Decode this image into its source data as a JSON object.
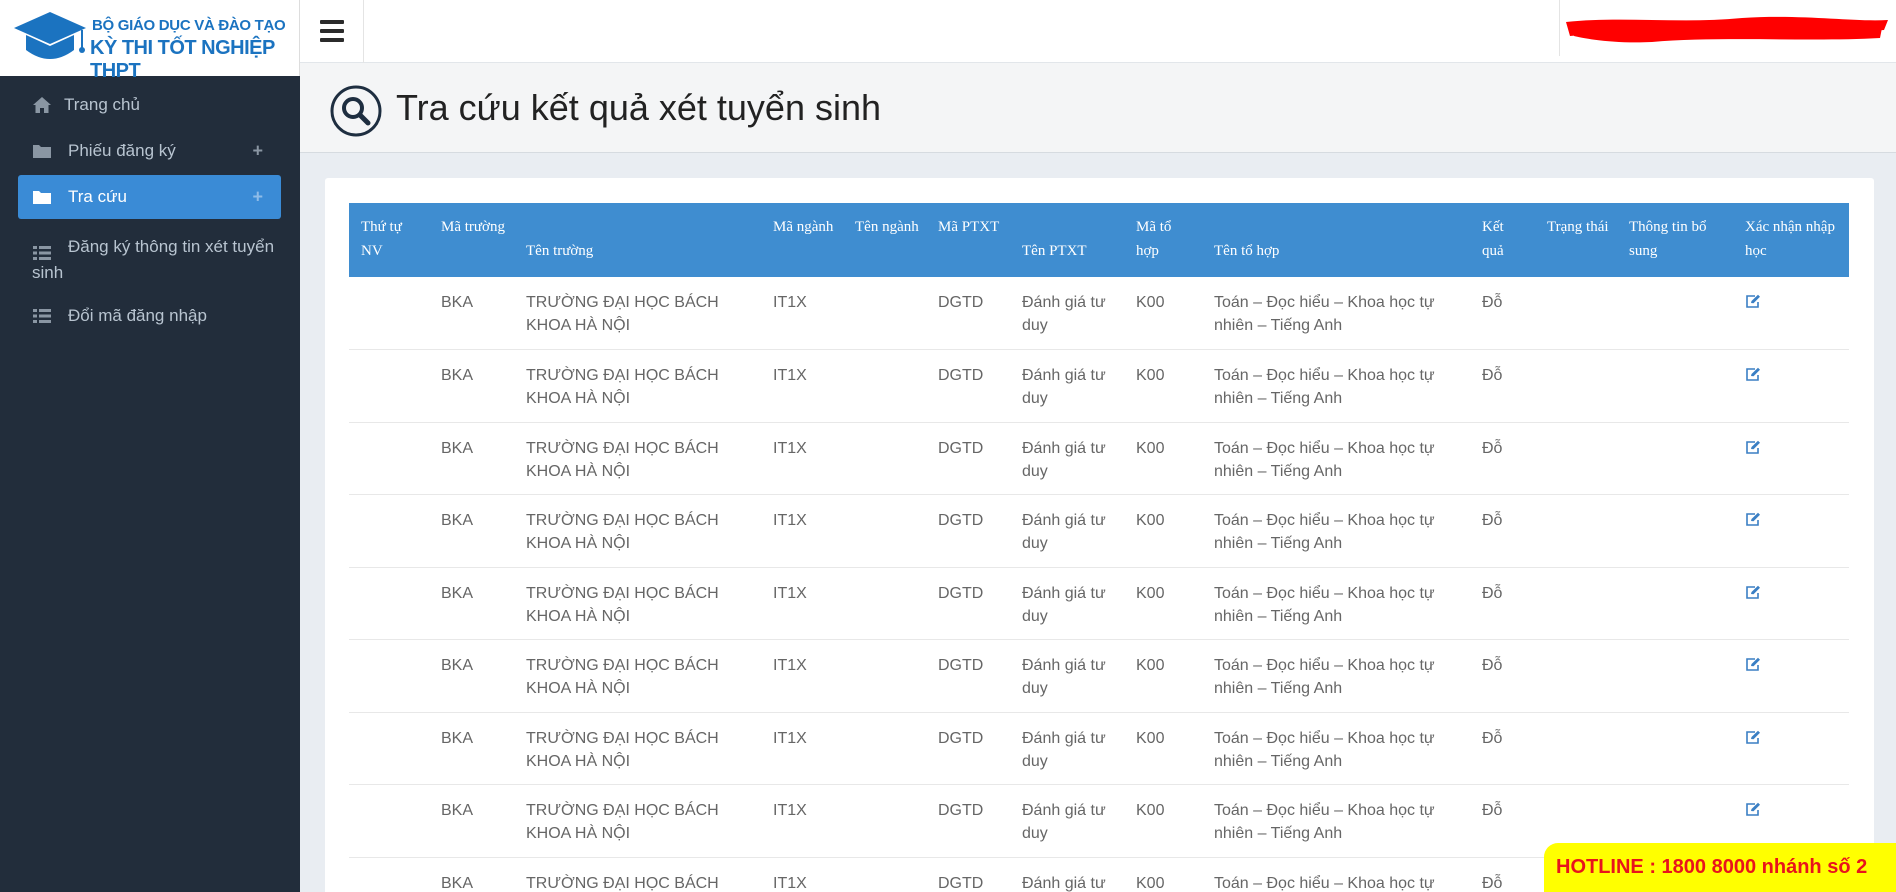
{
  "logo": {
    "line1": "BỘ GIÁO DỤC VÀ ĐÀO TẠO",
    "line2": "KỲ THI TỐT NGHIỆP THPT"
  },
  "sidebar": {
    "items": [
      {
        "label": "Trang chủ",
        "icon": "home-icon"
      },
      {
        "label": "Phiếu đăng ký",
        "icon": "folder-icon",
        "expand": "+"
      },
      {
        "label": "Tra cứu",
        "icon": "folder-icon",
        "expand": "+",
        "active": true
      },
      {
        "label": "Đăng ký thông tin xét tuyển",
        "label_cont": "sinh",
        "icon": "list-icon"
      },
      {
        "label": "Đổi mã đăng nhập",
        "icon": "list-icon"
      }
    ]
  },
  "header": {
    "title": "Tra cứu kết quả xét tuyển sinh"
  },
  "table": {
    "columns": [
      "Thứ tự NV",
      "Mã trường",
      "Tên trường",
      "Mã ngành",
      "Tên ngành",
      "Mã PTXT",
      "Tên PTXT",
      "Mã tổ hợp",
      "Tên tổ hợp",
      "Kết quả",
      "Trạng thái",
      "Thông tin bổ sung",
      "Xác nhận nhập học"
    ],
    "rows": [
      [
        "",
        "BKA",
        "TRƯỜNG ĐẠI HỌC BÁCH KHOA HÀ NỘI",
        "IT1X",
        "",
        "DGTD",
        "Đánh giá tư duy",
        "K00",
        "Toán – Đọc hiểu – Khoa học tự nhiên – Tiếng Anh",
        "Đỗ",
        "",
        ""
      ],
      [
        "",
        "BKA",
        "TRƯỜNG ĐẠI HỌC BÁCH KHOA HÀ NỘI",
        "IT1X",
        "",
        "DGTD",
        "Đánh giá tư duy",
        "K00",
        "Toán – Đọc hiểu – Khoa học tự nhiên – Tiếng Anh",
        "Đỗ",
        "",
        ""
      ],
      [
        "",
        "BKA",
        "TRƯỜNG ĐẠI HỌC BÁCH KHOA HÀ NỘI",
        "IT1X",
        "",
        "DGTD",
        "Đánh giá tư duy",
        "K00",
        "Toán – Đọc hiểu – Khoa học tự nhiên – Tiếng Anh",
        "Đỗ",
        "",
        ""
      ],
      [
        "",
        "BKA",
        "TRƯỜNG ĐẠI HỌC BÁCH KHOA HÀ NỘI",
        "IT1X",
        "",
        "DGTD",
        "Đánh giá tư duy",
        "K00",
        "Toán – Đọc hiểu – Khoa học tự nhiên – Tiếng Anh",
        "Đỗ",
        "",
        ""
      ],
      [
        "",
        "BKA",
        "TRƯỜNG ĐẠI HỌC BÁCH KHOA HÀ NỘI",
        "IT1X",
        "",
        "DGTD",
        "Đánh giá tư duy",
        "K00",
        "Toán – Đọc hiểu – Khoa học tự nhiên – Tiếng Anh",
        "Đỗ",
        "",
        ""
      ],
      [
        "",
        "BKA",
        "TRƯỜNG ĐẠI HỌC BÁCH KHOA HÀ NỘI",
        "IT1X",
        "",
        "DGTD",
        "Đánh giá tư duy",
        "K00",
        "Toán – Đọc hiểu – Khoa học tự nhiên – Tiếng Anh",
        "Đỗ",
        "",
        ""
      ],
      [
        "",
        "BKA",
        "TRƯỜNG ĐẠI HỌC BÁCH KHOA HÀ NỘI",
        "IT1X",
        "",
        "DGTD",
        "Đánh giá tư duy",
        "K00",
        "Toán – Đọc hiểu – Khoa học tự nhiên – Tiếng Anh",
        "Đỗ",
        "",
        ""
      ],
      [
        "",
        "BKA",
        "TRƯỜNG ĐẠI HỌC BÁCH KHOA HÀ NỘI",
        "IT1X",
        "",
        "DGTD",
        "Đánh giá tư duy",
        "K00",
        "Toán – Đọc hiểu – Khoa học tự nhiên – Tiếng Anh",
        "Đỗ",
        "",
        ""
      ],
      [
        "",
        "BKA",
        "TRƯỜNG ĐẠI HỌC BÁCH KHOA HÀ NỘI",
        "IT1X",
        "",
        "DGTD",
        "Đánh giá tư duy",
        "K00",
        "Toán – Đọc hiểu – Khoa học tự nhiên – Tiếng Anh",
        "Đỗ",
        "",
        ""
      ]
    ],
    "action_icon": "edit-icon"
  },
  "hotline": {
    "text": "HOTLINE : 1800 8000 nhánh số 2"
  },
  "colors": {
    "sidebar_bg": "#222d3b",
    "active_nav": "#3a8bd6",
    "table_header": "#3f8dd0",
    "brand_blue": "#1b73c0",
    "hotline_bg": "#ffff00",
    "hotline_text": "#e8141c",
    "redaction": "#ff0000"
  }
}
